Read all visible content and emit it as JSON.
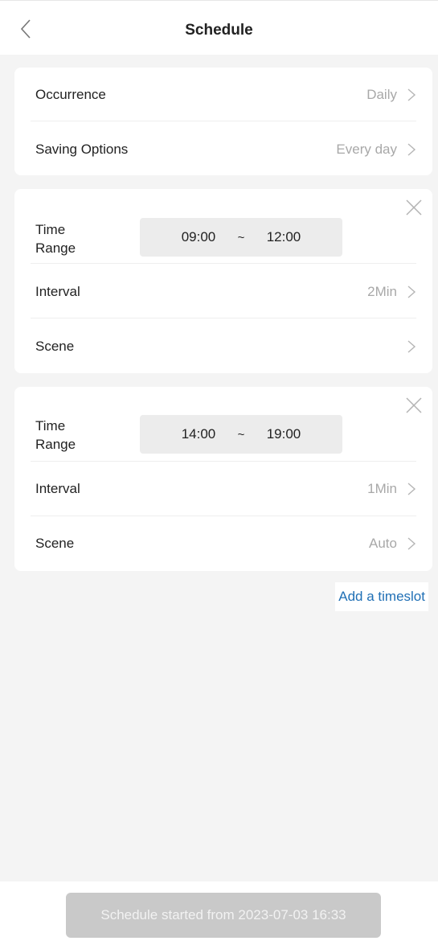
{
  "header": {
    "title": "Schedule",
    "back_icon": "chevron-left-icon"
  },
  "general": {
    "occurrence": {
      "label": "Occurrence",
      "value": "Daily"
    },
    "saving_options": {
      "label": "Saving Options",
      "value": "Every day"
    }
  },
  "timeslots": [
    {
      "time_label_line1": "Time",
      "time_label_line2": "Range",
      "start": "09:00",
      "separator": "~",
      "end": "12:00",
      "interval": {
        "label": "Interval",
        "value": "2Min"
      },
      "scene": {
        "label": "Scene",
        "value": ""
      }
    },
    {
      "time_label_line1": "Time",
      "time_label_line2": "Range",
      "start": "14:00",
      "separator": "~",
      "end": "19:00",
      "interval": {
        "label": "Interval",
        "value": "1Min"
      },
      "scene": {
        "label": "Scene",
        "value": "Auto"
      }
    }
  ],
  "actions": {
    "add_timeslot": "Add a timeslot"
  },
  "footer": {
    "status_button": "Schedule started from 2023-07-03 16:33"
  },
  "colors": {
    "accent_link": "#1f6fb5",
    "background": "#f4f4f4",
    "muted_text": "#a8a8a8"
  }
}
